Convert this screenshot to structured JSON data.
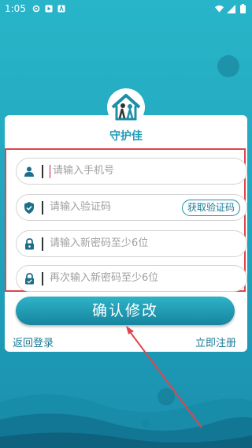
{
  "status_bar": {
    "time": "1:05",
    "icons": [
      "settings-icon",
      "play-icon",
      "font-icon",
      "wifi-icon",
      "signal-icon",
      "battery-icon"
    ]
  },
  "app": {
    "logo_text": "守护佳"
  },
  "form": {
    "phone_placeholder": "请输入手机号",
    "code_placeholder": "请输入验证码",
    "get_code_label": "获取验证码",
    "new_password_placeholder": "请输入新密码至少6位",
    "confirm_password_placeholder": "再次输入新密码至少6位"
  },
  "actions": {
    "confirm_label": "确认修改",
    "back_login_label": "返回登录",
    "register_label": "立即注册"
  },
  "colors": {
    "background": "#1fa3bb",
    "accent": "#1b8fae",
    "highlight_box": "#e0454b"
  }
}
